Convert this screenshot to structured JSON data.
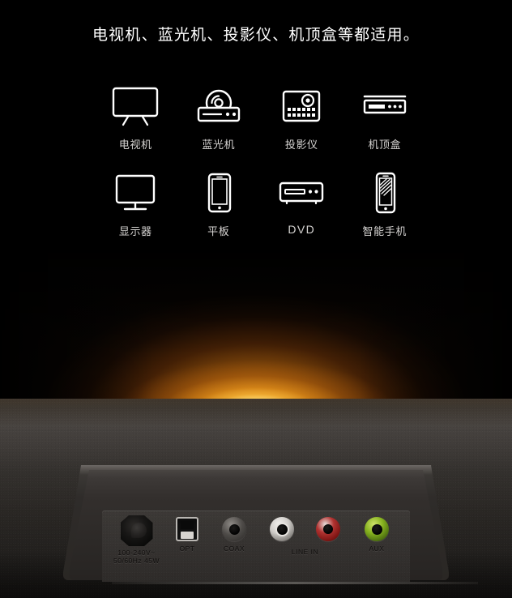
{
  "headline": "电视机、蓝光机、投影仪、机顶盒等都适用。",
  "compatibility": {
    "row1": [
      {
        "label": "电视机",
        "icon": "tv-icon"
      },
      {
        "label": "蓝光机",
        "icon": "bluray-player-icon"
      },
      {
        "label": "投影仪",
        "icon": "projector-icon"
      },
      {
        "label": "机顶盒",
        "icon": "set-top-box-icon"
      }
    ],
    "row2": [
      {
        "label": "显示器",
        "icon": "monitor-icon"
      },
      {
        "label": "平板",
        "icon": "tablet-icon"
      },
      {
        "label": "DVD",
        "icon": "dvd-player-icon"
      },
      {
        "label": "智能手机",
        "icon": "smartphone-icon"
      }
    ]
  },
  "ports": [
    {
      "label_line1": "100-240V~",
      "label_line2": "50/60Hz  45W",
      "type": "ac-power-inlet",
      "color": "#0a0a09"
    },
    {
      "label_line1": "OPT",
      "type": "optical-toslink",
      "color": "#b9b6b2"
    },
    {
      "label_line1": "COAX",
      "type": "coaxial-rca",
      "color": "#4e4b48"
    },
    {
      "label_line1": "LINE IN",
      "type": "line-in-rca-pair",
      "colors": [
        "#cfccc8",
        "#b03230"
      ]
    },
    {
      "label_line1": "AUX",
      "type": "aux-rca",
      "color": "#86b21f"
    }
  ],
  "colors": {
    "glow_core": "#ffeaaa",
    "glow_mid": "#f3981a",
    "glow_outer": "#a84e0a",
    "background": "#000000",
    "icon_stroke": "#ffffff",
    "icon_label": "#d6d4d2",
    "soundbar_body": "#3a3733",
    "port_label": "#100e0d"
  }
}
